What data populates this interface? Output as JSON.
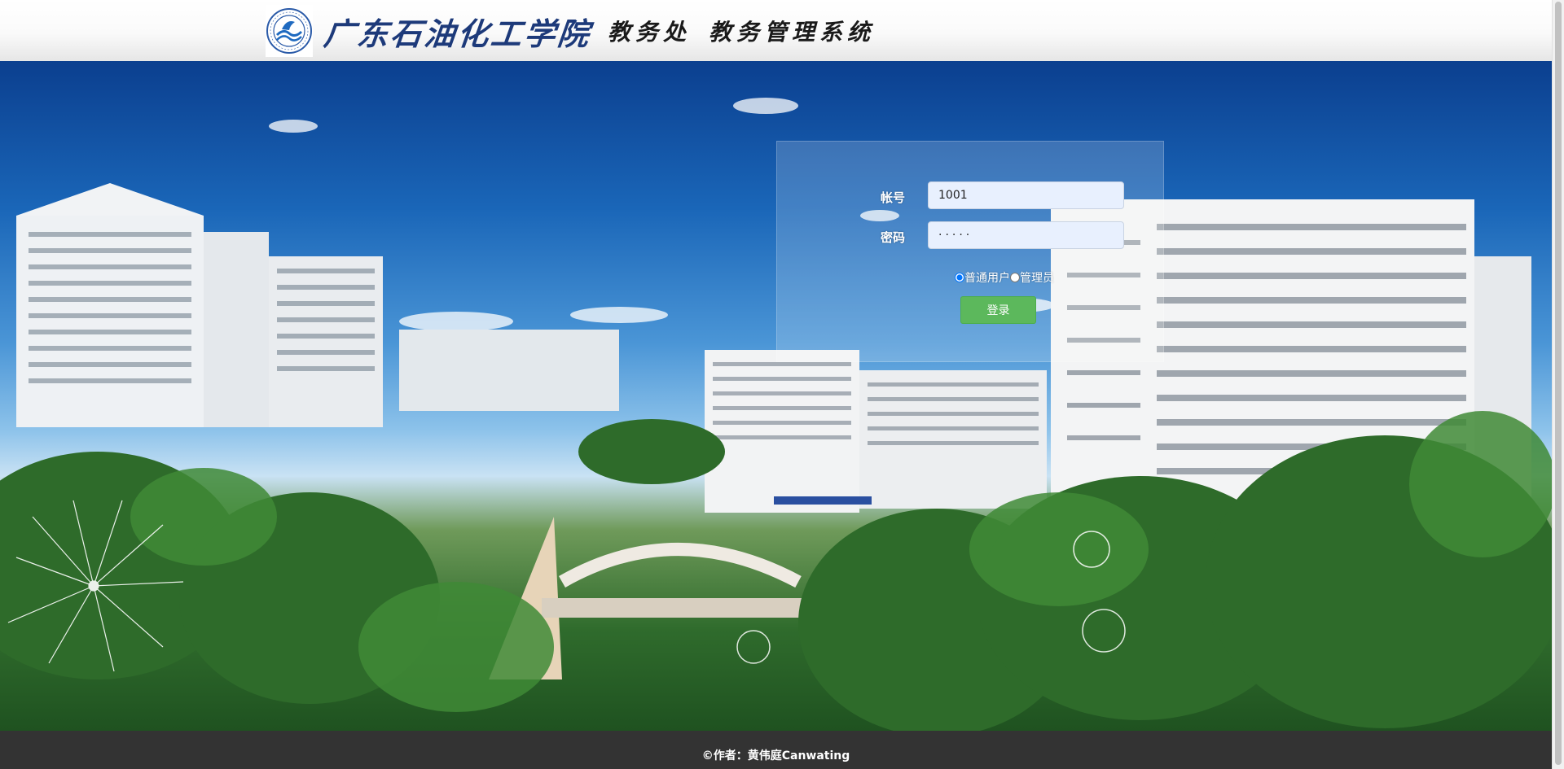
{
  "header": {
    "school_name": "广东石油化工学院",
    "office_name": "教务处",
    "system_name": "教务管理系统"
  },
  "login": {
    "account_label": "帐号",
    "account_value": "1001",
    "password_label": "密码",
    "password_value": "·····",
    "role_options": [
      {
        "label": "普通用户",
        "checked": true
      },
      {
        "label": "管理员",
        "checked": false
      }
    ],
    "submit_label": "登录"
  },
  "footer": {
    "text": "©作者：黄伟庭Canwating"
  },
  "colors": {
    "login_button": "#5cb85c",
    "footer_bg": "#333333",
    "school_name": "#1d3a7a"
  }
}
